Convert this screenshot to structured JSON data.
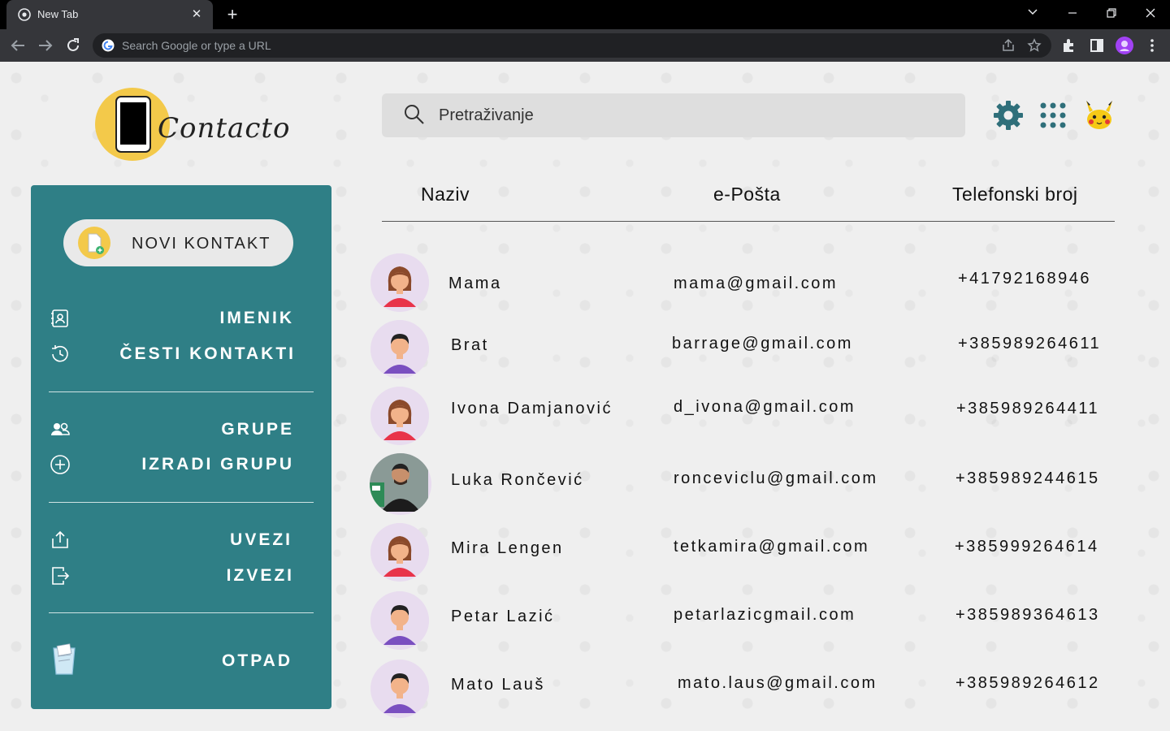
{
  "browser": {
    "tab_title": "New Tab",
    "new_tab_symbol": "+",
    "omnibox_placeholder": "Search Google or type a URL"
  },
  "app": {
    "logo_text": "Contacto",
    "search_placeholder": "Pretraživanje",
    "header_icons": [
      "gear-icon",
      "apps-grid-icon",
      "profile-avatar-icon"
    ]
  },
  "sidebar": {
    "new_contact_label": "NOVI KONTAKT",
    "items": [
      {
        "label": "IMENIK",
        "icon": "contacts-book-icon"
      },
      {
        "label": "ČESTI KONTAKTI",
        "icon": "history-icon"
      },
      {
        "label": "GRUPE",
        "icon": "group-icon"
      },
      {
        "label": "IZRADI GRUPU",
        "icon": "add-circle-icon"
      },
      {
        "label": "UVEZI",
        "icon": "share-upload-icon"
      },
      {
        "label": "IZVEZI",
        "icon": "export-icon"
      },
      {
        "label": "OTPAD",
        "icon": "trash-icon"
      }
    ],
    "colors": {
      "panel": "#2f7f86",
      "accent": "#f3c94a"
    }
  },
  "table": {
    "headers": {
      "name": "Naziv",
      "email": "e-Pošta",
      "phone": "Telefonski broj"
    },
    "rows": [
      {
        "name": "Mama",
        "email": "mama@gmail.com",
        "phone": "+41792168946",
        "avatar": "female"
      },
      {
        "name": "Brat",
        "email": "barrage@gmail.com",
        "phone": "+385989264611",
        "avatar": "male"
      },
      {
        "name": "Ivona Damjanović",
        "email": "d_ivona@gmail.com",
        "phone": "+385989264411",
        "avatar": "female"
      },
      {
        "name": "Luka Rončević",
        "email": "ronceviclu@gmail.com",
        "phone": "+385989244615",
        "avatar": "photo"
      },
      {
        "name": "Mira Lengen",
        "email": "tetkamira@gmail.com",
        "phone": "+385999264614",
        "avatar": "female"
      },
      {
        "name": "Petar Lazić",
        "email": "petarlazicgmail.com",
        "phone": "+385989364613",
        "avatar": "male"
      },
      {
        "name": "Mato Lauš",
        "email": "mato.laus@gmail.com",
        "phone": "+385989264612",
        "avatar": "male"
      }
    ]
  }
}
